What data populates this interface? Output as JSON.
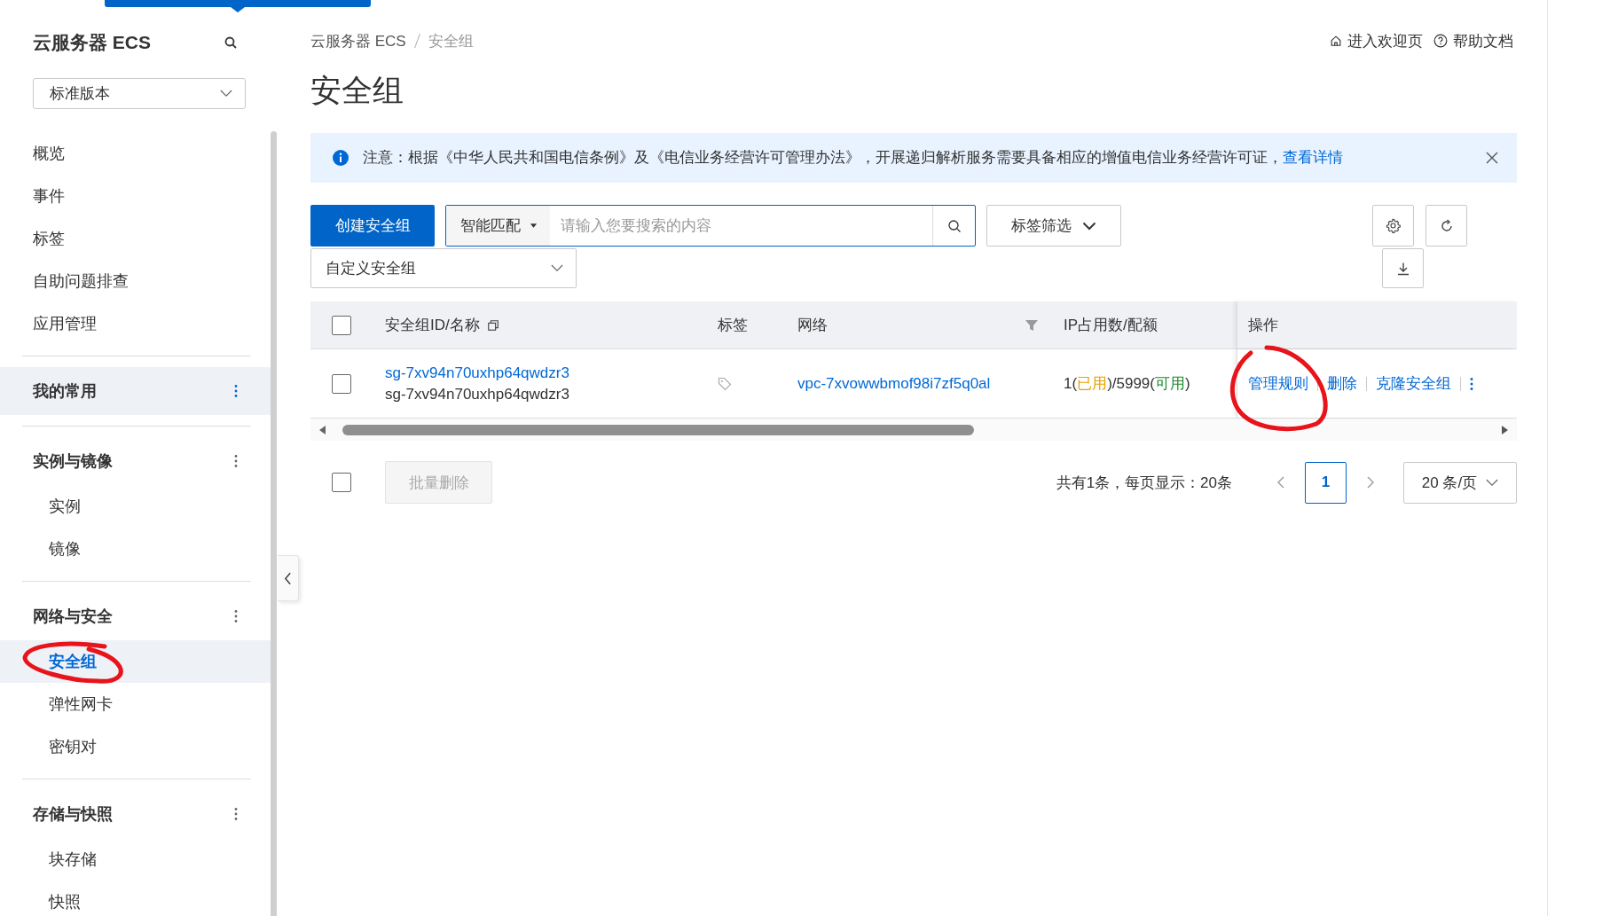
{
  "sidebar": {
    "title": "云服务器 ECS",
    "edition": "标准版本",
    "items": [
      {
        "label": "概览",
        "selected": false
      },
      {
        "label": "事件",
        "selected": false
      },
      {
        "label": "标签",
        "selected": false
      },
      {
        "label": "自助问题排查",
        "selected": false
      },
      {
        "label": "应用管理",
        "selected": false
      }
    ],
    "groups": [
      {
        "title": "我的常用",
        "hovered": true
      },
      {
        "title": "实例与镜像",
        "hovered": false,
        "children": [
          {
            "label": "实例",
            "selected": false
          },
          {
            "label": "镜像",
            "selected": false
          }
        ]
      },
      {
        "title": "网络与安全",
        "hovered": false,
        "children": [
          {
            "label": "安全组",
            "selected": true
          },
          {
            "label": "弹性网卡",
            "selected": false
          },
          {
            "label": "密钥对",
            "selected": false
          }
        ]
      },
      {
        "title": "存储与快照",
        "hovered": false,
        "children": [
          {
            "label": "块存储",
            "selected": false
          },
          {
            "label": "快照",
            "selected": false
          }
        ]
      }
    ]
  },
  "breadcrumb": [
    "云服务器 ECS",
    "安全组"
  ],
  "header_links": [
    {
      "label": "进入欢迎页",
      "kind": "home"
    },
    {
      "label": "帮助文档",
      "kind": "help"
    }
  ],
  "page_title": "安全组",
  "notice": {
    "text": "注意：根据《中华人民共和国电信条例》及《电信业务经营许可管理办法》，开展递归解析服务需要具备相应的增值电信业务经营许可证，",
    "link": "查看详情"
  },
  "toolbar": {
    "create_button": "创建安全组",
    "search_mode": "智能匹配",
    "search_placeholder": "请输入您要搜索的内容",
    "tag_filter": "标签筛选",
    "group_select": "自定义安全组"
  },
  "table": {
    "all_checked": false,
    "columns": [
      {
        "label": "安全组ID/名称",
        "kind": "copy"
      },
      {
        "label": "标签",
        "kind": "plain"
      },
      {
        "label": "网络",
        "kind": "filter"
      },
      {
        "label": "IP占用数/配额",
        "kind": "plain"
      },
      {
        "label": "操作",
        "kind": "plain"
      }
    ],
    "rows": [
      {
        "checked": false,
        "id": "sg-7xv94n70uxhp64qwdzr3",
        "name": "sg-7xv94n70uxhp64qwdzr3",
        "network": "vpc-7xvowwbmof98i7zf5q0al",
        "ip_usage": [
          {
            "text": "1(",
            "kind": "plain"
          },
          {
            "text": "已用",
            "kind": "used"
          },
          {
            "text": ")/5999(",
            "kind": "plain"
          },
          {
            "text": "可用",
            "kind": "available"
          },
          {
            "text": ")",
            "kind": "plain"
          }
        ],
        "actions": [
          "管理规则",
          "删除",
          "克隆安全组"
        ]
      }
    ]
  },
  "footer": {
    "select_all_checked": false,
    "batch_delete": {
      "label": "批量删除",
      "disabled": true
    },
    "summary": "共有1条，每页显示：20条",
    "pages": [
      {
        "label": "1",
        "selected": true
      }
    ],
    "page_size": "20 条/页"
  }
}
